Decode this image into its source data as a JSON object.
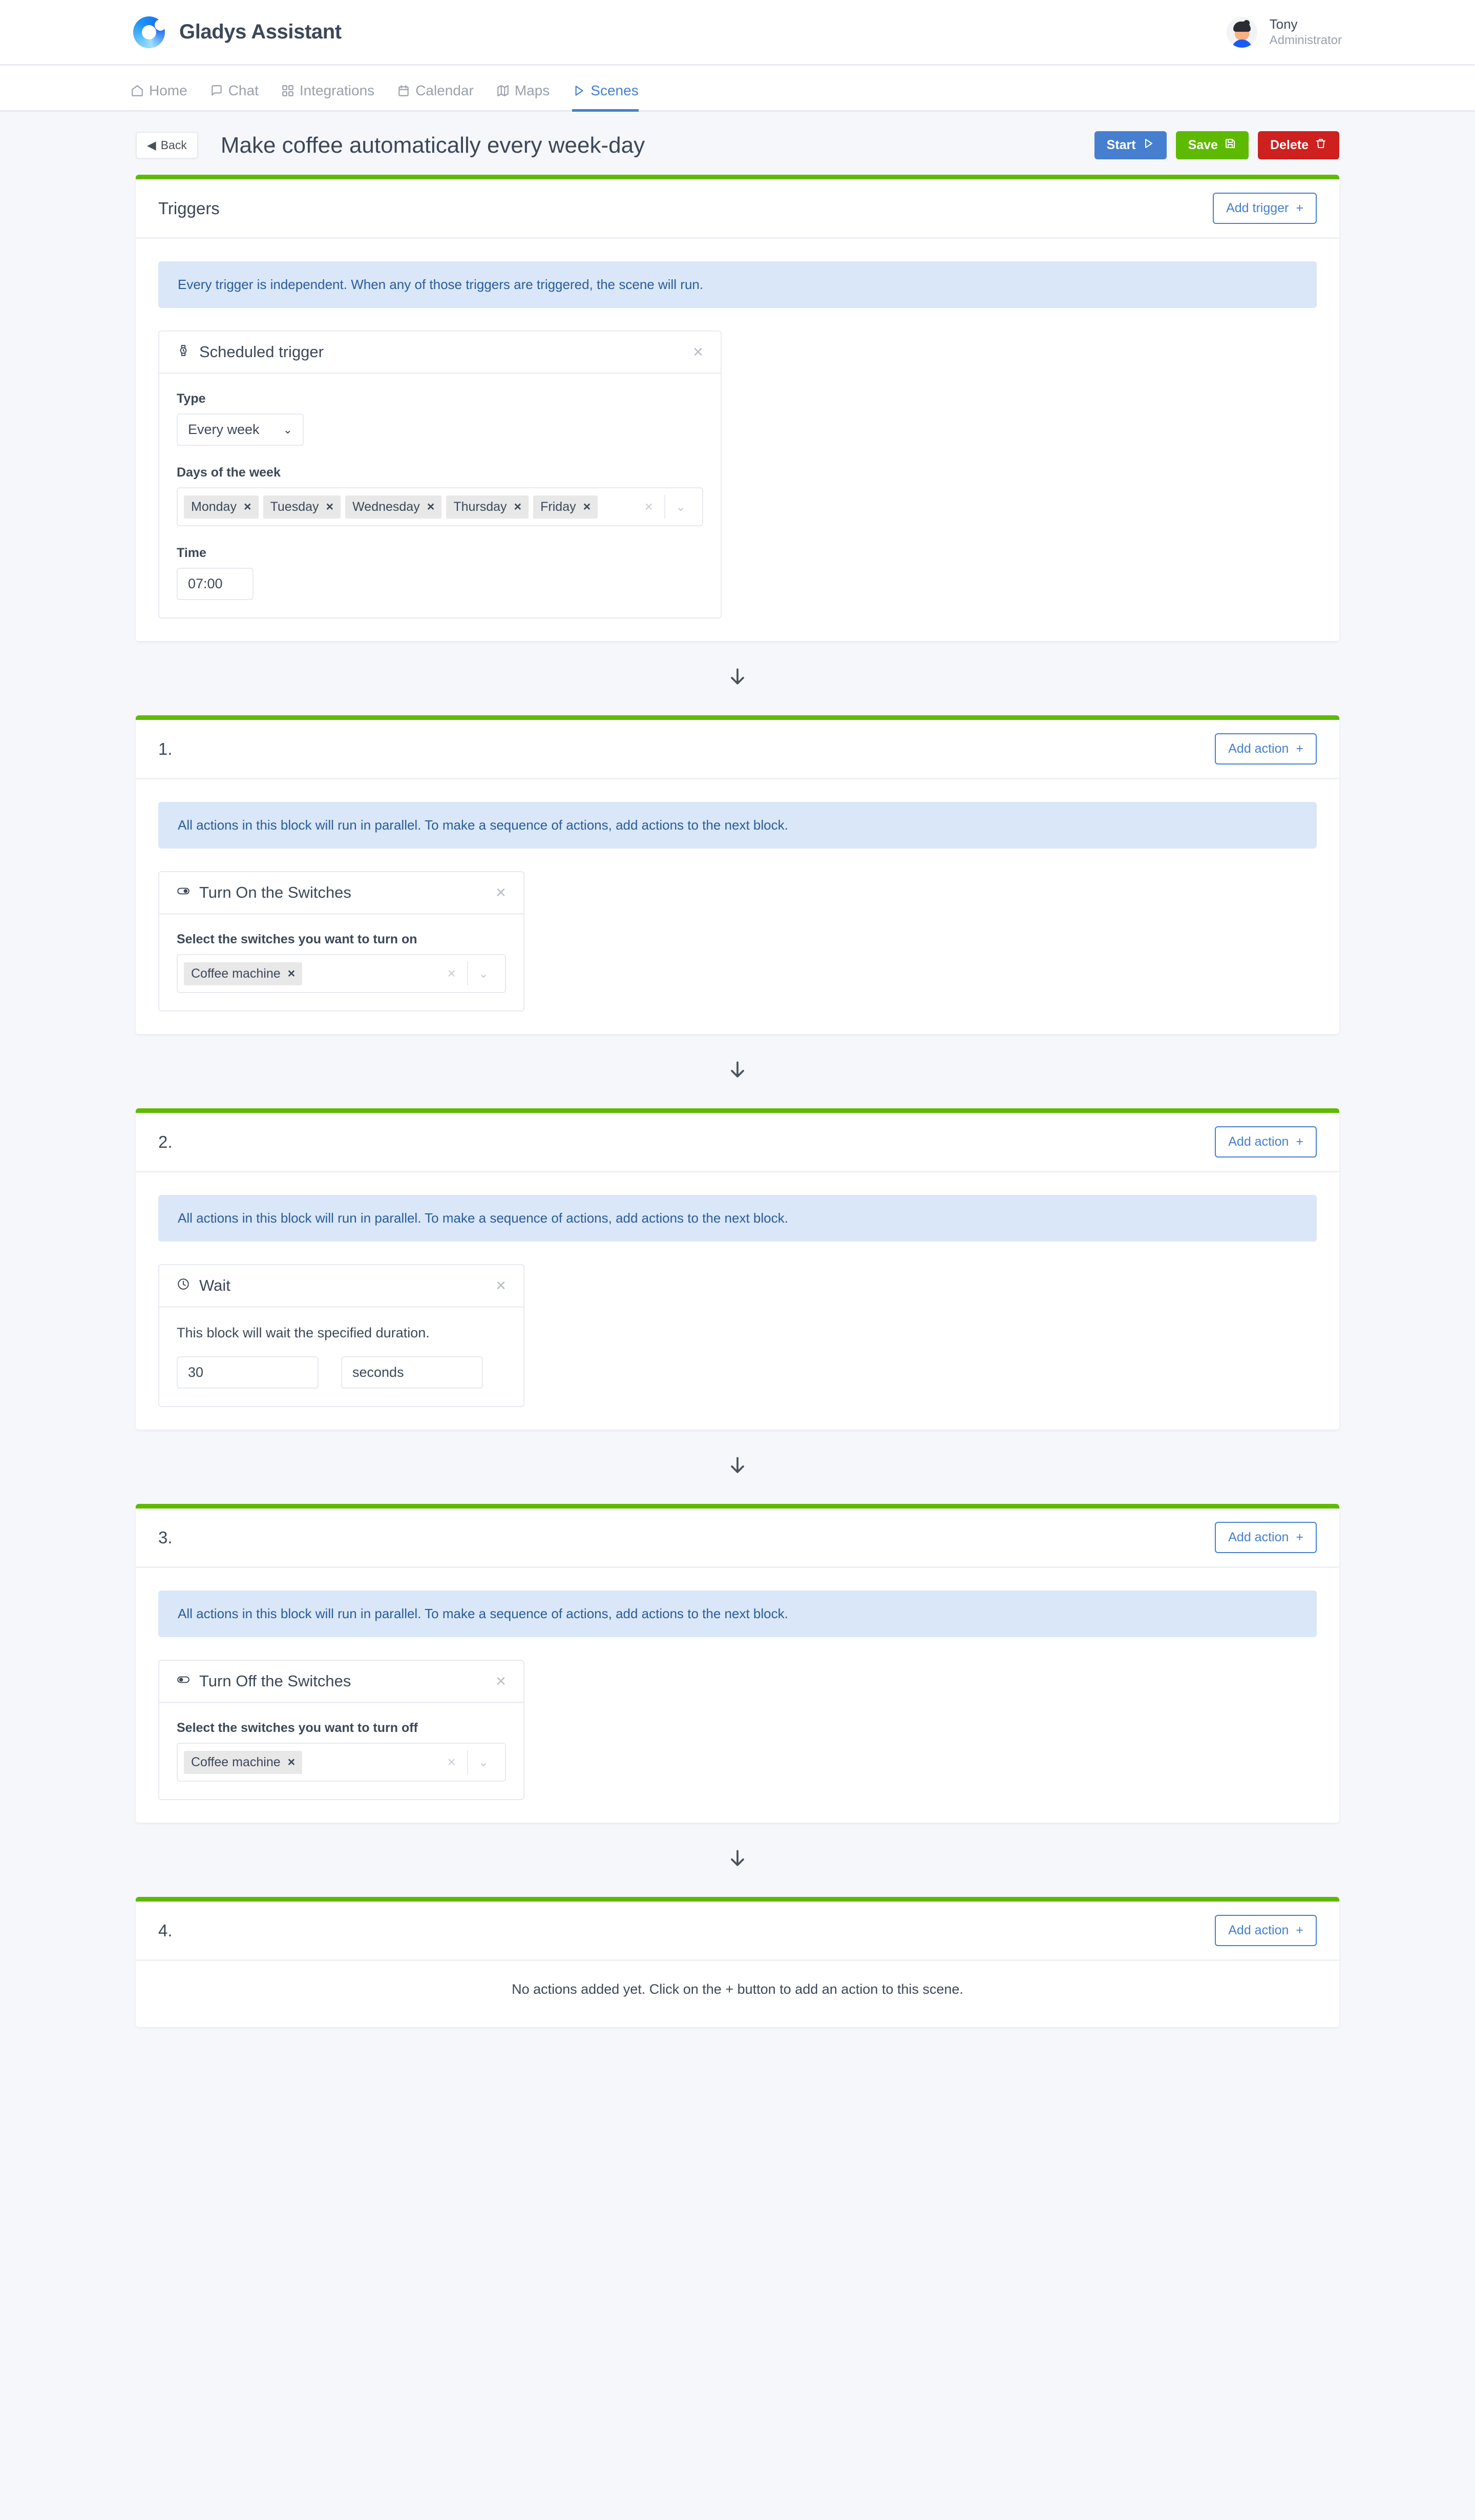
{
  "app": {
    "brand_name": "Gladys Assistant",
    "logo_icon": "gladys-logo-ring"
  },
  "user": {
    "name": "Tony",
    "role": "Administrator",
    "avatar_icon": "user-avatar"
  },
  "nav": {
    "items": [
      {
        "label": "Home",
        "icon": "home-icon",
        "active": false
      },
      {
        "label": "Chat",
        "icon": "chat-bubble-icon",
        "active": false
      },
      {
        "label": "Integrations",
        "icon": "grid-icon",
        "active": false
      },
      {
        "label": "Calendar",
        "icon": "calendar-icon",
        "active": false
      },
      {
        "label": "Maps",
        "icon": "map-icon",
        "active": false
      },
      {
        "label": "Scenes",
        "icon": "play-triangle-icon",
        "active": true
      }
    ]
  },
  "page": {
    "back_label": "Back",
    "title": "Make coffee automatically every week-day",
    "buttons": {
      "start": "Start",
      "save": "Save",
      "delete": "Delete"
    },
    "colors": {
      "start": "#467fcf",
      "save": "#5eba00",
      "delete": "#cd201f",
      "card_top_accent": "#5eba00",
      "alert_bg": "#d9e7f8",
      "alert_text": "#2b5c9b",
      "page_bg": "#f5f7fb"
    }
  },
  "triggers_card": {
    "title": "Triggers",
    "add_label": "Add trigger",
    "info": "Every trigger is independent. When any of those triggers are triggered, the scene will run.",
    "trigger": {
      "title": "Scheduled trigger",
      "icon": "watch-icon",
      "type_label": "Type",
      "type_value": "Every week",
      "days_label": "Days of the week",
      "days": [
        "Monday",
        "Tuesday",
        "Wednesday",
        "Thursday",
        "Friday"
      ],
      "time_label": "Time",
      "time_value": "07:00"
    }
  },
  "blocks": [
    {
      "number": "1.",
      "add_label": "Add action",
      "info": "All actions in this block will run in parallel. To make a sequence of actions, add actions to the next block.",
      "action": {
        "kind": "switch",
        "title": "Turn On the Switches",
        "icon": "toggle-on-icon",
        "field_label": "Select the switches you want to turn on",
        "chips": [
          "Coffee machine"
        ]
      }
    },
    {
      "number": "2.",
      "add_label": "Add action",
      "info": "All actions in this block will run in parallel. To make a sequence of actions, add actions to the next block.",
      "action": {
        "kind": "wait",
        "title": "Wait",
        "icon": "clock-icon",
        "note": "This block will wait the specified duration.",
        "amount": "30",
        "unit": "seconds"
      }
    },
    {
      "number": "3.",
      "add_label": "Add action",
      "info": "All actions in this block will run in parallel. To make a sequence of actions, add actions to the next block.",
      "action": {
        "kind": "switch",
        "title": "Turn Off the Switches",
        "icon": "toggle-off-icon",
        "field_label": "Select the switches you want to turn off",
        "chips": [
          "Coffee machine"
        ]
      }
    },
    {
      "number": "4.",
      "add_label": "Add action",
      "empty_message": "No actions added yet. Click on the + button to add an action to this scene."
    }
  ],
  "icons": {
    "arrow_down": "arrow-down-icon",
    "plus": "plus-icon",
    "close": "close-icon"
  }
}
